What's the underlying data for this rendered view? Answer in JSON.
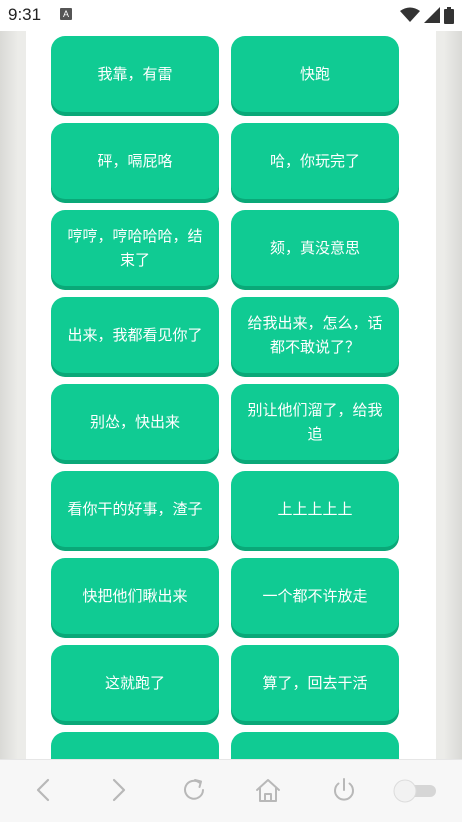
{
  "status_bar": {
    "time": "9:31",
    "notification_badge": "A",
    "icons": [
      "wifi-icon",
      "signal-icon",
      "battery-icon"
    ]
  },
  "buttons": [
    {
      "label": "我靠，有雷"
    },
    {
      "label": "快跑"
    },
    {
      "label": "砰，嗝屁咯"
    },
    {
      "label": "哈，你玩完了"
    },
    {
      "label": "哼哼，哼哈哈哈，结束了"
    },
    {
      "label": "颏，真没意思"
    },
    {
      "label": "出来，我都看见你了"
    },
    {
      "label": "给我出来，怎么，话都不敢说了？"
    },
    {
      "label": "别怂，快出来"
    },
    {
      "label": "别让他们溜了，给我追"
    },
    {
      "label": "看你干的好事，渣子"
    },
    {
      "label": "上上上上上"
    },
    {
      "label": "快把他们瞅出来"
    },
    {
      "label": "一个都不许放走"
    },
    {
      "label": "这就跑了"
    },
    {
      "label": "算了，回去干活"
    },
    {
      "label": ""
    },
    {
      "label": ""
    }
  ],
  "nav": {
    "icons": [
      "back-icon",
      "forward-icon",
      "refresh-icon",
      "home-icon",
      "power-icon",
      "toggle-switch"
    ]
  },
  "colors": {
    "button_bg": "#10cb93",
    "button_shadow": "#0aa878",
    "nav_icon": "#b8b8b8"
  }
}
